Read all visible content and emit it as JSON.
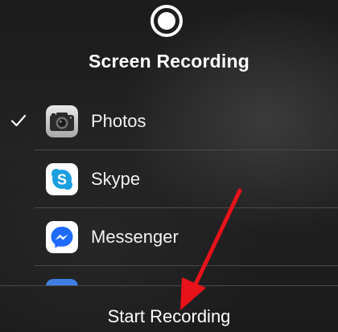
{
  "header": {
    "icon": "record-icon",
    "title": "Screen Recording"
  },
  "apps": [
    {
      "label": "Photos",
      "icon": "photos-camera-icon",
      "selected": true
    },
    {
      "label": "Skype",
      "icon": "skype-icon",
      "selected": false
    },
    {
      "label": "Messenger",
      "icon": "messenger-icon",
      "selected": false
    },
    {
      "label": "",
      "icon": "blue-app-icon",
      "selected": false
    }
  ],
  "action": {
    "start_label": "Start Recording"
  },
  "annotation": {
    "arrow_color": "#e8121a"
  },
  "colors": {
    "skype": "#1a9fe0",
    "messenger": "#1f6bff",
    "check": "#ffffff"
  }
}
